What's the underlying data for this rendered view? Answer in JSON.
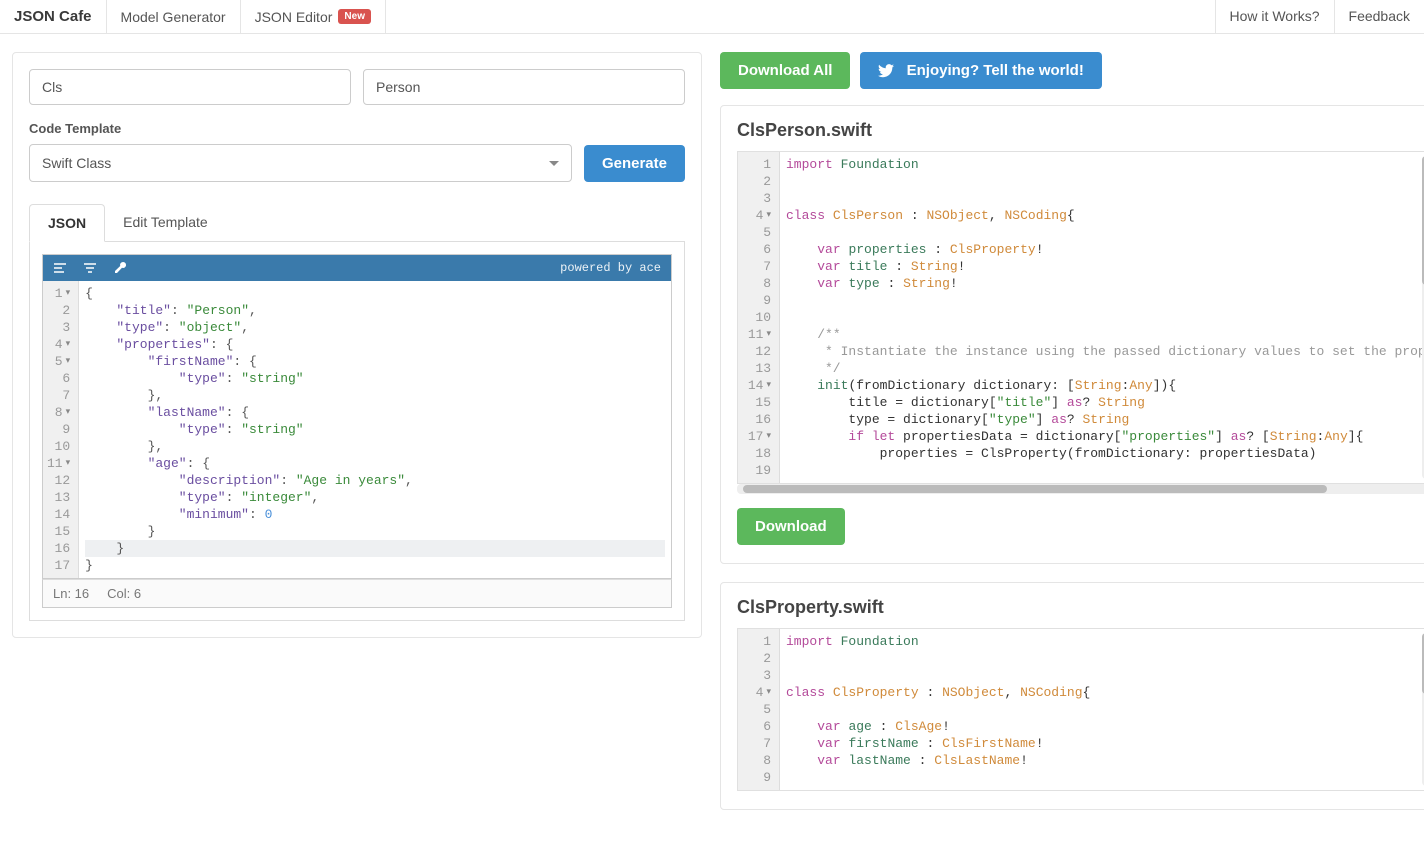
{
  "nav": {
    "brand": "JSON Cafe",
    "model_generator": "Model Generator",
    "json_editor": "JSON Editor",
    "new_badge": "New",
    "how_it_works": "How it Works?",
    "feedback": "Feedback"
  },
  "form": {
    "prefix_value": "Cls",
    "root_value": "Person",
    "code_template_label": "Code Template",
    "code_template_value": "Swift Class",
    "generate": "Generate"
  },
  "tabs": {
    "json": "JSON",
    "edit_template": "Edit Template"
  },
  "editor": {
    "powered": "powered by ace",
    "status_line": "Ln: 16",
    "status_col": "Col: 6",
    "lines": [
      {
        "n": 1,
        "fold": "▾",
        "html": "<span class='tok-punc'>{</span>"
      },
      {
        "n": 2,
        "html": "    <span class='tok-key'>\"title\"</span><span class='tok-punc'>:</span> <span class='tok-str'>\"Person\"</span><span class='tok-punc'>,</span>"
      },
      {
        "n": 3,
        "html": "    <span class='tok-key'>\"type\"</span><span class='tok-punc'>:</span> <span class='tok-str'>\"object\"</span><span class='tok-punc'>,</span>"
      },
      {
        "n": 4,
        "fold": "▾",
        "html": "    <span class='tok-key'>\"properties\"</span><span class='tok-punc'>:</span> <span class='tok-punc'>{</span>"
      },
      {
        "n": 5,
        "fold": "▾",
        "html": "        <span class='tok-key'>\"firstName\"</span><span class='tok-punc'>:</span> <span class='tok-punc'>{</span>"
      },
      {
        "n": 6,
        "html": "            <span class='tok-key'>\"type\"</span><span class='tok-punc'>:</span> <span class='tok-str'>\"string\"</span>"
      },
      {
        "n": 7,
        "html": "        <span class='tok-punc'>},</span>"
      },
      {
        "n": 8,
        "fold": "▾",
        "html": "        <span class='tok-key'>\"lastName\"</span><span class='tok-punc'>:</span> <span class='tok-punc'>{</span>"
      },
      {
        "n": 9,
        "html": "            <span class='tok-key'>\"type\"</span><span class='tok-punc'>:</span> <span class='tok-str'>\"string\"</span>"
      },
      {
        "n": 10,
        "html": "        <span class='tok-punc'>},</span>"
      },
      {
        "n": 11,
        "fold": "▾",
        "html": "        <span class='tok-key'>\"age\"</span><span class='tok-punc'>:</span> <span class='tok-punc'>{</span>"
      },
      {
        "n": 12,
        "html": "            <span class='tok-key'>\"description\"</span><span class='tok-punc'>:</span> <span class='tok-str'>\"Age in years\"</span><span class='tok-punc'>,</span>"
      },
      {
        "n": 13,
        "html": "            <span class='tok-key'>\"type\"</span><span class='tok-punc'>:</span> <span class='tok-str'>\"integer\"</span><span class='tok-punc'>,</span>"
      },
      {
        "n": 14,
        "html": "            <span class='tok-key'>\"minimum\"</span><span class='tok-punc'>:</span> <span class='tok-num'>0</span>"
      },
      {
        "n": 15,
        "html": "        <span class='tok-punc'>}</span>"
      },
      {
        "n": 16,
        "cursor": true,
        "html": "    <span class='tok-punc'>}</span>"
      },
      {
        "n": 17,
        "html": "<span class='tok-punc'>}</span>"
      }
    ]
  },
  "actions": {
    "download_all": "Download All",
    "tell_world": "Enjoying? Tell the world!",
    "download": "Download"
  },
  "files": [
    {
      "title": "ClsPerson.swift",
      "scrollbar_h": true,
      "lines": [
        {
          "n": 1,
          "html": "<span class='tok-kw'>import</span> <span class='tok-ident'>Foundation</span>"
        },
        {
          "n": 2,
          "html": " "
        },
        {
          "n": 3,
          "html": " "
        },
        {
          "n": 4,
          "fold": "▾",
          "html": "<span class='tok-kw'>class</span> <span class='tok-type'>ClsPerson</span> : <span class='tok-type'>NSObject</span>, <span class='tok-type'>NSCoding</span>{"
        },
        {
          "n": 5,
          "html": " "
        },
        {
          "n": 6,
          "html": "    <span class='tok-kw'>var</span> <span class='tok-ident'>properties</span> : <span class='tok-type'>ClsProperty</span>!"
        },
        {
          "n": 7,
          "html": "    <span class='tok-kw'>var</span> <span class='tok-ident'>title</span> : <span class='tok-type'>String</span>!"
        },
        {
          "n": 8,
          "html": "    <span class='tok-kw'>var</span> <span class='tok-ident'>type</span> : <span class='tok-type'>String</span>!"
        },
        {
          "n": 9,
          "html": " "
        },
        {
          "n": 10,
          "html": " "
        },
        {
          "n": 11,
          "fold": "▾",
          "html": "    <span class='tok-comment'>/**</span>"
        },
        {
          "n": 12,
          "html": "<span class='tok-comment'>     * Instantiate the instance using the passed dictionary values to set the prop</span>"
        },
        {
          "n": 13,
          "html": "<span class='tok-comment'>     */</span>"
        },
        {
          "n": 14,
          "fold": "▾",
          "html": "    <span class='tok-ident'>init</span>(fromDictionary dictionary: [<span class='tok-type'>String</span>:<span class='tok-type'>Any</span>]){"
        },
        {
          "n": 15,
          "html": "        title = dictionary[<span class='tok-str'>\"title\"</span>] <span class='tok-kw'>as</span>? <span class='tok-type'>String</span>"
        },
        {
          "n": 16,
          "html": "        type = dictionary[<span class='tok-str'>\"type\"</span>] <span class='tok-kw'>as</span>? <span class='tok-type'>String</span>"
        },
        {
          "n": 17,
          "fold": "▾",
          "html": "        <span class='tok-kw'>if let</span> propertiesData = dictionary[<span class='tok-str'>\"properties\"</span>] <span class='tok-kw'>as</span>? [<span class='tok-type'>String</span>:<span class='tok-type'>Any</span>]{"
        },
        {
          "n": 18,
          "html": "            properties = ClsProperty(fromDictionary: propertiesData)"
        },
        {
          "n": 19,
          "html": " "
        }
      ]
    },
    {
      "title": "ClsProperty.swift",
      "lines": [
        {
          "n": 1,
          "html": "<span class='tok-kw'>import</span> <span class='tok-ident'>Foundation</span>"
        },
        {
          "n": 2,
          "html": " "
        },
        {
          "n": 3,
          "html": " "
        },
        {
          "n": 4,
          "fold": "▾",
          "html": "<span class='tok-kw'>class</span> <span class='tok-type'>ClsProperty</span> : <span class='tok-type'>NSObject</span>, <span class='tok-type'>NSCoding</span>{"
        },
        {
          "n": 5,
          "html": " "
        },
        {
          "n": 6,
          "html": "    <span class='tok-kw'>var</span> <span class='tok-ident'>age</span> : <span class='tok-type'>ClsAge</span>!"
        },
        {
          "n": 7,
          "html": "    <span class='tok-kw'>var</span> <span class='tok-ident'>firstName</span> : <span class='tok-type'>ClsFirstName</span>!"
        },
        {
          "n": 8,
          "html": "    <span class='tok-kw'>var</span> <span class='tok-ident'>lastName</span> : <span class='tok-type'>ClsLastName</span>!"
        },
        {
          "n": 9,
          "html": " "
        }
      ]
    }
  ]
}
